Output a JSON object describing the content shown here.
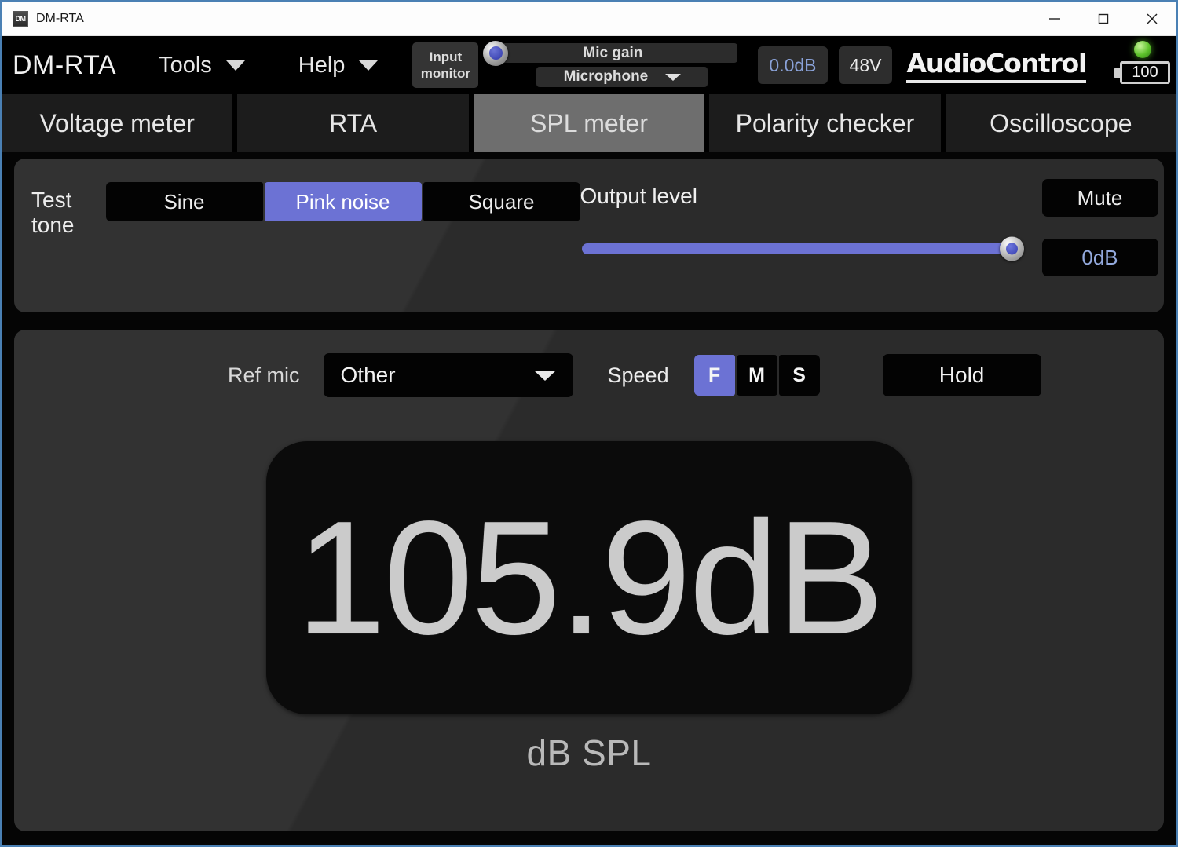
{
  "window": {
    "title": "DM-RTA",
    "app_icon": "DM",
    "controls": {
      "minimize": "minimize-icon",
      "maximize": "maximize-icon",
      "close": "close-icon"
    }
  },
  "toolbar": {
    "brand": "DM-RTA",
    "menus": [
      {
        "label": "Tools",
        "caret": "chevron-down-icon"
      },
      {
        "label": "Help",
        "caret": "chevron-down-icon"
      }
    ],
    "input_monitor": {
      "line1": "Input",
      "line2": "monitor"
    },
    "mic_gain": {
      "label": "Mic gain",
      "knob_position_pct": 0
    },
    "mic_source": {
      "value": "Microphone",
      "caret": "chevron-down-icon"
    },
    "gain_value": "0.0dB",
    "phantom_power": "48V",
    "logo": "AudioControl",
    "status_led": "green-led-icon",
    "battery": {
      "level": "100",
      "icon": "battery-icon"
    }
  },
  "tabs": [
    {
      "label": "Voltage meter",
      "active": false
    },
    {
      "label": "RTA",
      "active": false
    },
    {
      "label": "SPL meter",
      "active": true
    },
    {
      "label": "Polarity checker",
      "active": false
    },
    {
      "label": "Oscilloscope",
      "active": false
    }
  ],
  "test_tone": {
    "label": "Test tone",
    "options": [
      {
        "label": "Sine",
        "active": false
      },
      {
        "label": "Pink noise",
        "active": true
      },
      {
        "label": "Square",
        "active": false
      }
    ]
  },
  "output": {
    "label": "Output level",
    "slider_value_pct": 100,
    "mute_label": "Mute",
    "level_value": "0dB"
  },
  "spl": {
    "ref_mic_label": "Ref mic",
    "ref_mic_value": "Other",
    "speed_label": "Speed",
    "speed_options": [
      {
        "label": "F",
        "active": true
      },
      {
        "label": "M",
        "active": false
      },
      {
        "label": "S",
        "active": false
      }
    ],
    "hold_label": "Hold",
    "reading": "105.9dB",
    "unit": "dB SPL"
  },
  "colors": {
    "accent": "#6c72d4",
    "panel": "#2b2b2b",
    "readout_bg": "#0b0b0b",
    "tab_active": "#6e6e6e",
    "led_green": "#5cc12a",
    "value_blue": "#8aa2d8"
  }
}
